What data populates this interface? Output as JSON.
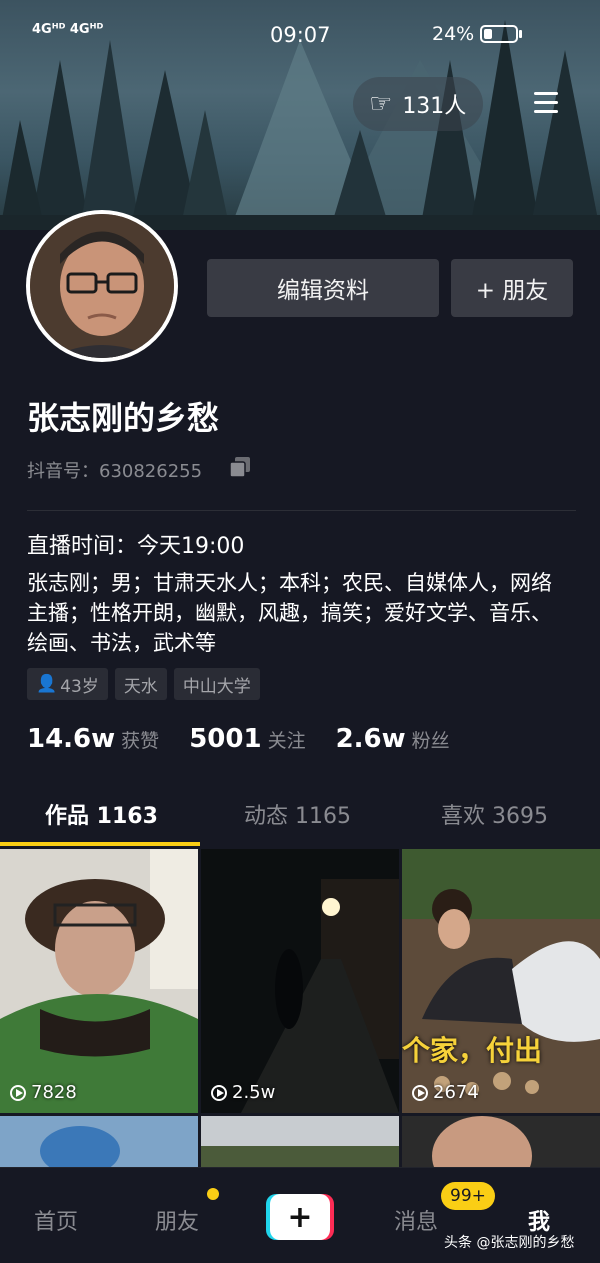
{
  "status_bar": {
    "network": "4Gᴴᴰ 4Gᴴᴰ",
    "time": "09:07",
    "battery": "24%"
  },
  "header": {
    "visitors": "131人",
    "visitors_icon": "hand-wave-icon",
    "menu_icon": "menu-icon"
  },
  "profile": {
    "edit_label": "编辑资料",
    "add_friend_label": "+ 朋友",
    "name": "张志刚的乡愁",
    "douyin_id": "抖音号：630826255",
    "live_time": "直播时间：今天19:00",
    "bio": "张志刚；男；甘肃天水人；本科；农民、自媒体人，网络主播；性格开朗，幽默，风趣，搞笑；爱好文学、音乐、绘画、书法，武术等",
    "tags": [
      "43岁",
      "天水",
      "中山大学"
    ]
  },
  "stats": [
    {
      "value": "14.6w",
      "label": "获赞"
    },
    {
      "value": "5001",
      "label": "关注"
    },
    {
      "value": "2.6w",
      "label": "粉丝"
    }
  ],
  "tabs": [
    {
      "label": "作品 1163"
    },
    {
      "label": "动态 1165"
    },
    {
      "label": "喜欢 3695"
    }
  ],
  "videos": [
    {
      "count": "7828"
    },
    {
      "count": "2.5w"
    },
    {
      "count": "2674"
    }
  ],
  "video_caption": "个家，付出",
  "nav": {
    "home": "首页",
    "friends": "朋友",
    "messages": "消息",
    "messages_badge": "99+",
    "me": "我"
  },
  "watermark": "头条 @张志刚的乡愁",
  "colors": {
    "accent": "#face15",
    "background": "#161823"
  }
}
